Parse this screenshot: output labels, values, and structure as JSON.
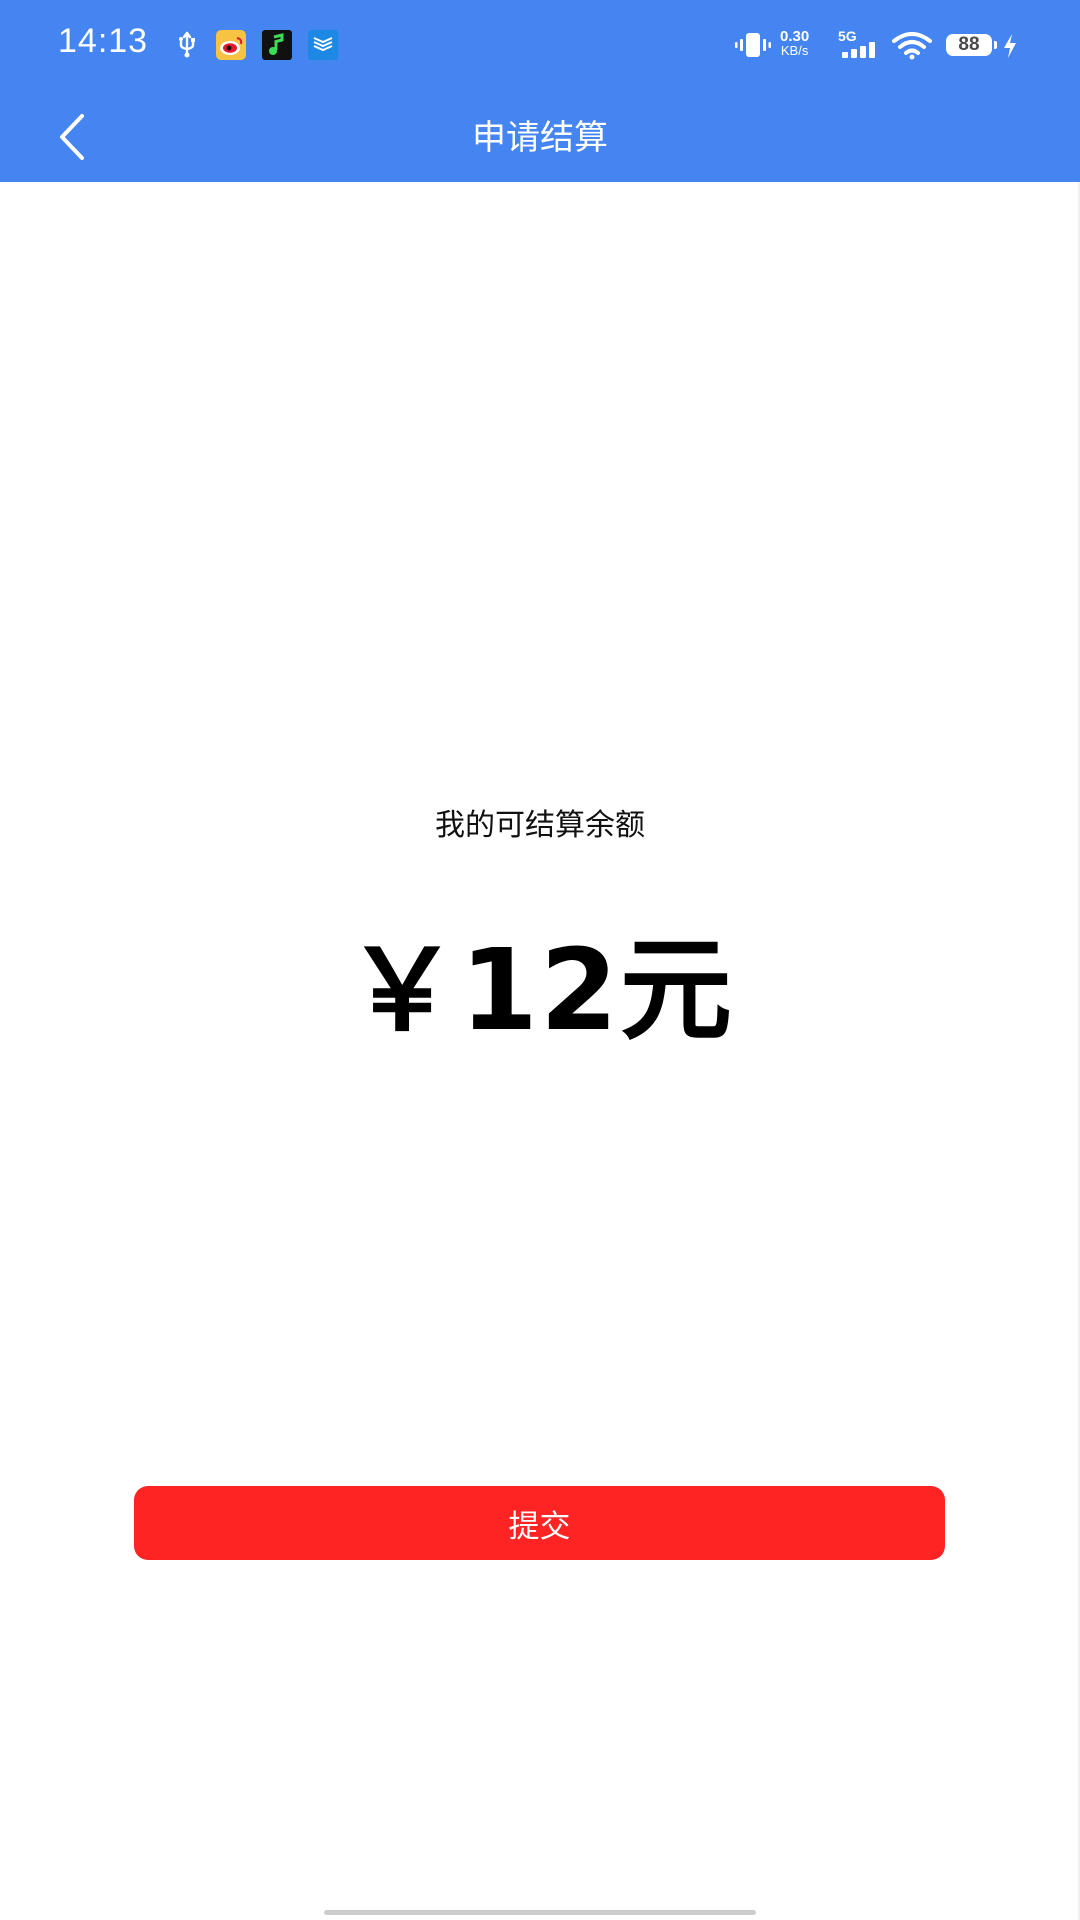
{
  "status_bar": {
    "time": "14:13",
    "net_speed_value": "0.30",
    "net_speed_unit": "KB/s",
    "network_type": "5G",
    "battery_level": "88",
    "icons": [
      "usb-icon",
      "weibo-icon",
      "music-app-icon",
      "stack-app-icon",
      "vibrate-icon",
      "signal-icon",
      "wifi-icon",
      "battery-icon",
      "charging-icon"
    ]
  },
  "header": {
    "title": "申请结算",
    "back_icon": "chevron-left-icon"
  },
  "balance": {
    "label": "我的可结算余额",
    "amount": "￥12元"
  },
  "actions": {
    "submit_label": "提交"
  },
  "colors": {
    "header_bg": "#4585F2",
    "submit_bg": "#FF2424",
    "text_primary": "#000000"
  }
}
